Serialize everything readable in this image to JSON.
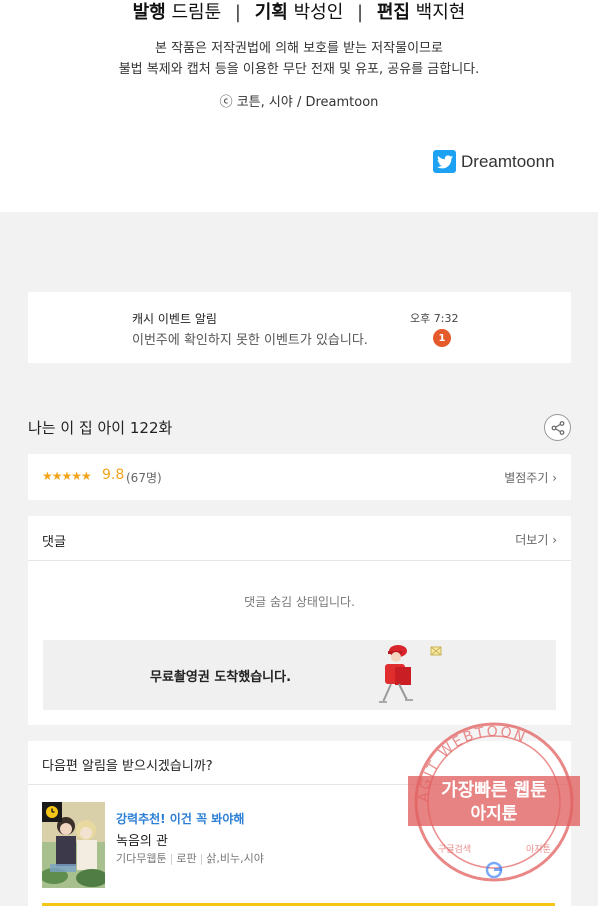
{
  "credits": {
    "publish_label": "발행",
    "publish_value": "드림툰",
    "plan_label": "기획",
    "plan_value": "박성인",
    "edit_label": "편집",
    "edit_value": "백지현",
    "notice_line1": "본 작품은 저작권법에 의해 보호를 받는 저작물이므로",
    "notice_line2": "불법 복제와 캡처 등을 이용한 무단 전재 및 유포, 공유를 금합니다.",
    "copyright": "ⓒ 코튼, 시야 / Dreamtoon",
    "twitter_handle": "Dreamtoonn"
  },
  "notification": {
    "title": "캐시 이벤트 알림",
    "time": "오후 7:32",
    "message": "이번주에 확인하지 못한 이벤트가 있습니다.",
    "badge": "1"
  },
  "episode": {
    "title": "나는 이 집 아이 122화"
  },
  "rating": {
    "stars": "★★★★★",
    "score": "9.8",
    "count": "(67명)",
    "rate_button": "별점주기 ›"
  },
  "comments": {
    "title": "댓글",
    "more": "더보기 ›",
    "hidden_status": "댓글 숨김 상태입니다.",
    "banner_text": "무료촬영권 도착했습니다."
  },
  "next_episode": {
    "question": "다음편 알림을 받으시겠습니까?",
    "recommend": "강력추천! 이건 꼭 봐야해",
    "work_title": "녹음의 관",
    "tag1": "기다무웹툰",
    "tag2": "로판",
    "tag3": "삵,비누,시야"
  },
  "watermark": {
    "ring_text": "AGIT WEBTOON",
    "line1": "가장빠른 웹툰",
    "line2": "아지툰",
    "bottom_left": "구글검색",
    "bottom_right": "아지툰"
  },
  "colors": {
    "accent_orange": "#e55a2b",
    "star": "#f3a41b",
    "link_blue": "#2d7fd6",
    "twitter": "#1da1f2",
    "watermark_red": "#e26060"
  }
}
